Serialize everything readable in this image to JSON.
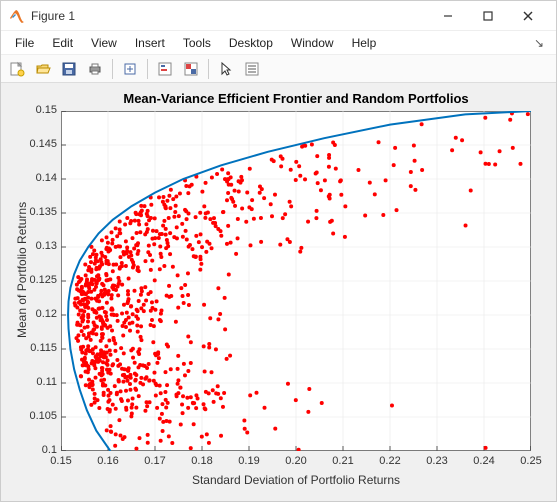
{
  "window": {
    "title": "Figure 1"
  },
  "menu": {
    "items": [
      "File",
      "Edit",
      "View",
      "Insert",
      "Tools",
      "Desktop",
      "Window",
      "Help"
    ]
  },
  "toolbar_icons": [
    "new-figure-icon",
    "open-icon",
    "save-icon",
    "print-icon",
    "sep",
    "link-icon",
    "sep",
    "data-cursor-icon",
    "brush-icon",
    "sep",
    "pointer-icon",
    "insert-legend-icon"
  ],
  "chart_data": {
    "type": "scatter+line",
    "title": "Mean-Variance Efficient Frontier and Random Portfolios",
    "xlabel": "Standard Deviation of Portfolio Returns",
    "ylabel": "Mean of Portfolio Returns",
    "xlim": [
      0.15,
      0.25
    ],
    "ylim": [
      0.1,
      0.15
    ],
    "xticks": [
      0.15,
      0.16,
      0.17,
      0.18,
      0.19,
      0.2,
      0.21,
      0.22,
      0.23,
      0.24,
      0.25
    ],
    "yticks": [
      0.1,
      0.105,
      0.11,
      0.115,
      0.12,
      0.125,
      0.13,
      0.135,
      0.14,
      0.145,
      0.15
    ],
    "frontier": [
      [
        0.1605,
        0.1
      ],
      [
        0.1575,
        0.103
      ],
      [
        0.1555,
        0.106
      ],
      [
        0.154,
        0.109
      ],
      [
        0.1528,
        0.112
      ],
      [
        0.152,
        0.115
      ],
      [
        0.1516,
        0.118
      ],
      [
        0.1515,
        0.12
      ],
      [
        0.1516,
        0.122
      ],
      [
        0.152,
        0.124
      ],
      [
        0.1528,
        0.126
      ],
      [
        0.154,
        0.128
      ],
      [
        0.1558,
        0.13
      ],
      [
        0.158,
        0.132
      ],
      [
        0.161,
        0.134
      ],
      [
        0.165,
        0.136
      ],
      [
        0.17,
        0.138
      ],
      [
        0.176,
        0.14
      ],
      [
        0.184,
        0.142
      ],
      [
        0.194,
        0.144
      ],
      [
        0.206,
        0.146
      ],
      [
        0.22,
        0.148
      ],
      [
        0.236,
        0.1495
      ],
      [
        0.25,
        0.15
      ]
    ],
    "n_random_points": 900,
    "random_seed": 42,
    "scatter_color": "#ff0000",
    "frontier_color": "#0072bd"
  }
}
